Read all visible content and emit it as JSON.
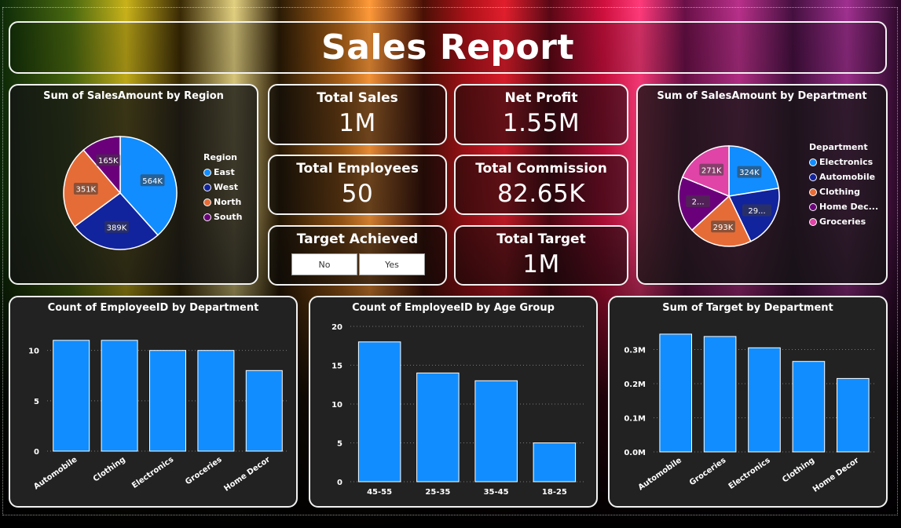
{
  "report": {
    "title": "Sales Report"
  },
  "kpis": {
    "total_sales": {
      "label": "Total Sales",
      "value": "1M"
    },
    "net_profit": {
      "label": "Net Profit",
      "value": "1.55M"
    },
    "total_employees": {
      "label": "Total Employees",
      "value": "50"
    },
    "total_commission": {
      "label": "Total Commission",
      "value": "82.65K"
    },
    "total_target": {
      "label": "Total Target",
      "value": "1M"
    }
  },
  "slicer": {
    "title": "Target Achieved",
    "options": [
      "No",
      "Yes"
    ]
  },
  "colors": {
    "blue": "#118DFF",
    "navy": "#12239E",
    "orange": "#E66C37",
    "purple": "#6B007B",
    "pink": "#E044A7",
    "bar": "#118DFF"
  },
  "chart_data": [
    {
      "type": "pie",
      "title": "Sum of SalesAmount by Region",
      "legend_title": "Region",
      "legend_position": "right",
      "categories": [
        "East",
        "West",
        "North",
        "South"
      ],
      "values": [
        564,
        389,
        351,
        165
      ],
      "labels": [
        "564K",
        "389K",
        "351K",
        "165K"
      ],
      "colors": [
        "#118DFF",
        "#12239E",
        "#E66C37",
        "#6B007B"
      ]
    },
    {
      "type": "pie",
      "title": "Sum of SalesAmount by Department",
      "legend_title": "Department",
      "legend_position": "right",
      "categories": [
        "Electronics",
        "Automobile",
        "Clothing",
        "Home Dec...",
        "Groceries"
      ],
      "values": [
        324,
        294,
        293,
        260,
        271
      ],
      "labels": [
        "324K",
        "29...",
        "293K",
        "2...",
        "271K"
      ],
      "colors": [
        "#118DFF",
        "#12239E",
        "#E66C37",
        "#6B007B",
        "#E044A7"
      ]
    },
    {
      "type": "bar",
      "title": "Count of EmployeeID by Department",
      "categories": [
        "Automobile",
        "Clothing",
        "Electronics",
        "Groceries",
        "Home Decor"
      ],
      "values": [
        11,
        11,
        10,
        10,
        8
      ],
      "ylim": [
        0,
        12
      ],
      "ticks": [
        0,
        5,
        10
      ],
      "tick_labels": [
        "0",
        "5",
        "10"
      ],
      "grid": true,
      "rotated_labels": true
    },
    {
      "type": "bar",
      "title": "Count of EmployeeID by Age Group",
      "categories": [
        "45-55",
        "25-35",
        "35-45",
        "18-25"
      ],
      "values": [
        18,
        14,
        13,
        5
      ],
      "ylim": [
        0,
        20
      ],
      "ticks": [
        0,
        5,
        10,
        15,
        20
      ],
      "tick_labels": [
        "0",
        "5",
        "10",
        "15",
        "20"
      ],
      "grid": true,
      "rotated_labels": false
    },
    {
      "type": "bar",
      "title": "Sum of Target by Department",
      "categories": [
        "Automobile",
        "Groceries",
        "Electronics",
        "Clothing",
        "Home Decor"
      ],
      "values": [
        0.345,
        0.338,
        0.305,
        0.265,
        0.215
      ],
      "ylim": [
        0,
        0.37
      ],
      "ticks": [
        0,
        0.1,
        0.2,
        0.3
      ],
      "tick_labels": [
        "0.0M",
        "0.1M",
        "0.2M",
        "0.3M"
      ],
      "grid": true,
      "rotated_labels": true
    }
  ]
}
